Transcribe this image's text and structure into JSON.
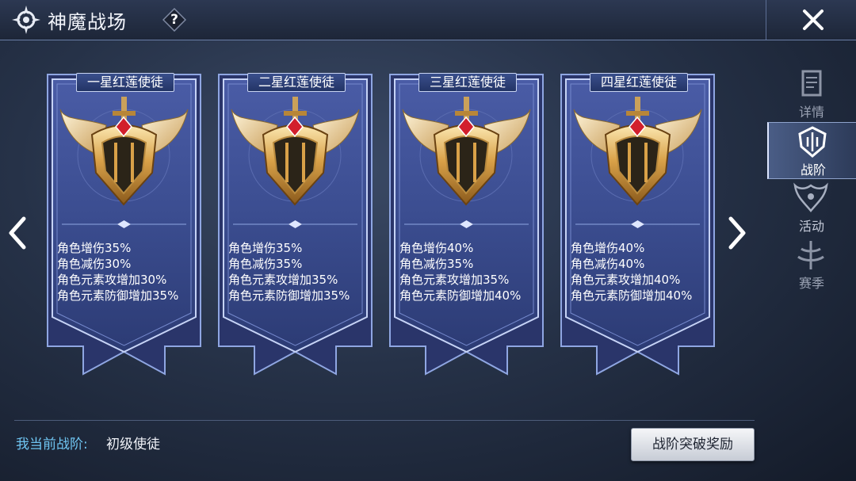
{
  "header": {
    "title": "神魔战场",
    "help_label": "?"
  },
  "cards": [
    {
      "title": "一星红莲使徒",
      "stats": [
        "角色增伤35%",
        "角色减伤30%",
        "角色元素攻增加30%",
        "角色元素防御增加35%"
      ]
    },
    {
      "title": "二星红莲使徒",
      "stats": [
        "角色增伤35%",
        "角色减伤35%",
        "角色元素攻增加35%",
        "角色元素防御增加35%"
      ]
    },
    {
      "title": "三星红莲使徒",
      "stats": [
        "角色增伤40%",
        "角色减伤35%",
        "角色元素攻增加35%",
        "角色元素防御增加40%"
      ]
    },
    {
      "title": "四星红莲使徒",
      "stats": [
        "角色增伤40%",
        "角色减伤40%",
        "角色元素攻增加40%",
        "角色元素防御增加40%"
      ]
    }
  ],
  "sidebar": {
    "tabs": [
      {
        "label": "详情",
        "icon": "scroll-icon",
        "state": "dim"
      },
      {
        "label": "战阶",
        "icon": "rank-crest-icon",
        "state": "active"
      },
      {
        "label": "活动",
        "icon": "event-crest-icon",
        "state": "normal"
      },
      {
        "label": "赛季",
        "icon": "season-crest-icon",
        "state": "dim"
      }
    ]
  },
  "footer": {
    "rank_label": "我当前战阶:",
    "rank_value": "初级使徒",
    "reward_button": "战阶突破奖励"
  },
  "colors": {
    "accent_cyan": "#6fc5f2",
    "card_blue": "#3e4f92",
    "gold": "#d8a24a",
    "gem_red": "#d21f2c"
  }
}
